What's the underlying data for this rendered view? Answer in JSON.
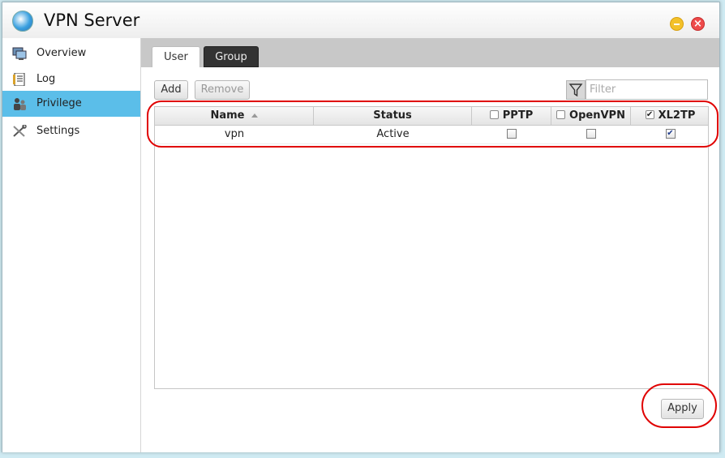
{
  "window": {
    "title": "VPN Server",
    "controls": [
      "minimize-icon",
      "close-icon"
    ],
    "close_glyph": "×"
  },
  "sidebar": {
    "items": [
      {
        "label": "Overview",
        "icon": "monitor-icon",
        "active": false
      },
      {
        "label": "Log",
        "icon": "log-icon",
        "active": false
      },
      {
        "label": "Privilege",
        "icon": "users-icon",
        "active": true
      },
      {
        "label": "Settings",
        "icon": "wrench-icon",
        "active": false
      }
    ],
    "active_color": "#5bbee9"
  },
  "tabs": [
    {
      "label": "User",
      "active": true
    },
    {
      "label": "Group",
      "active": false
    }
  ],
  "toolbar": {
    "add_label": "Add",
    "remove_label": "Remove",
    "remove_enabled": false,
    "filter_placeholder": "Filter",
    "filter_value": ""
  },
  "table": {
    "columns": [
      {
        "label": "Name",
        "sorted": "ascending"
      },
      {
        "label": "Status"
      },
      {
        "label": "PPTP",
        "header_checked": false
      },
      {
        "label": "OpenVPN",
        "header_checked": false
      },
      {
        "label": "XL2TP",
        "header_checked": true
      }
    ],
    "rows": [
      {
        "name": "vpn",
        "status": "Active",
        "pptp": false,
        "openvpn": false,
        "xl2tp": true
      }
    ]
  },
  "footer": {
    "apply_label": "Apply"
  },
  "annotation_color": "#e00000"
}
